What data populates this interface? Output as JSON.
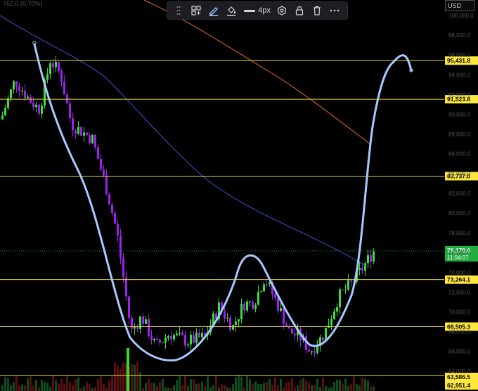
{
  "toolbar": {
    "width_label": "4px"
  },
  "axis": {
    "currency": "USD",
    "ticks": [
      "100,000.0",
      "98,000.0",
      "96,000.0",
      "94,000.0",
      "92,000.0",
      "90,000.0",
      "88,000.0",
      "86,000.0",
      "84,000.0",
      "82,000.0",
      "80,000.0",
      "78,000.0",
      "76,000.0",
      "74,000.0",
      "72,000.0",
      "70,000.0",
      "68,000.0",
      "66,000.0",
      "64,000.0"
    ]
  },
  "top_left_text": "762.0 (0.70%)",
  "levels": [
    {
      "label": "95,431.8",
      "value": 95431.8
    },
    {
      "label": "91,523.8",
      "value": 91523.8
    },
    {
      "label": "83,737.0",
      "value": 83737.0
    },
    {
      "label": "73,264.1",
      "value": 73264.1
    },
    {
      "label": "68,505.3",
      "value": 68505.3
    },
    {
      "label": "63,586.5",
      "value": 63586.5
    },
    {
      "label": "62,951.4",
      "value": 62951.4
    }
  ],
  "current": {
    "price": "76,170.6",
    "countdown": "11:04:07"
  },
  "colors": {
    "bull": "#39e03a",
    "bear": "#a020f0",
    "level": "#e6d235",
    "label_bg": "#ffe83a",
    "current_bg": "#1fae3f",
    "ma_blue": "#3a56c8",
    "ma_orange": "#e06a2a",
    "drawing": "#a9c8ff"
  }
}
